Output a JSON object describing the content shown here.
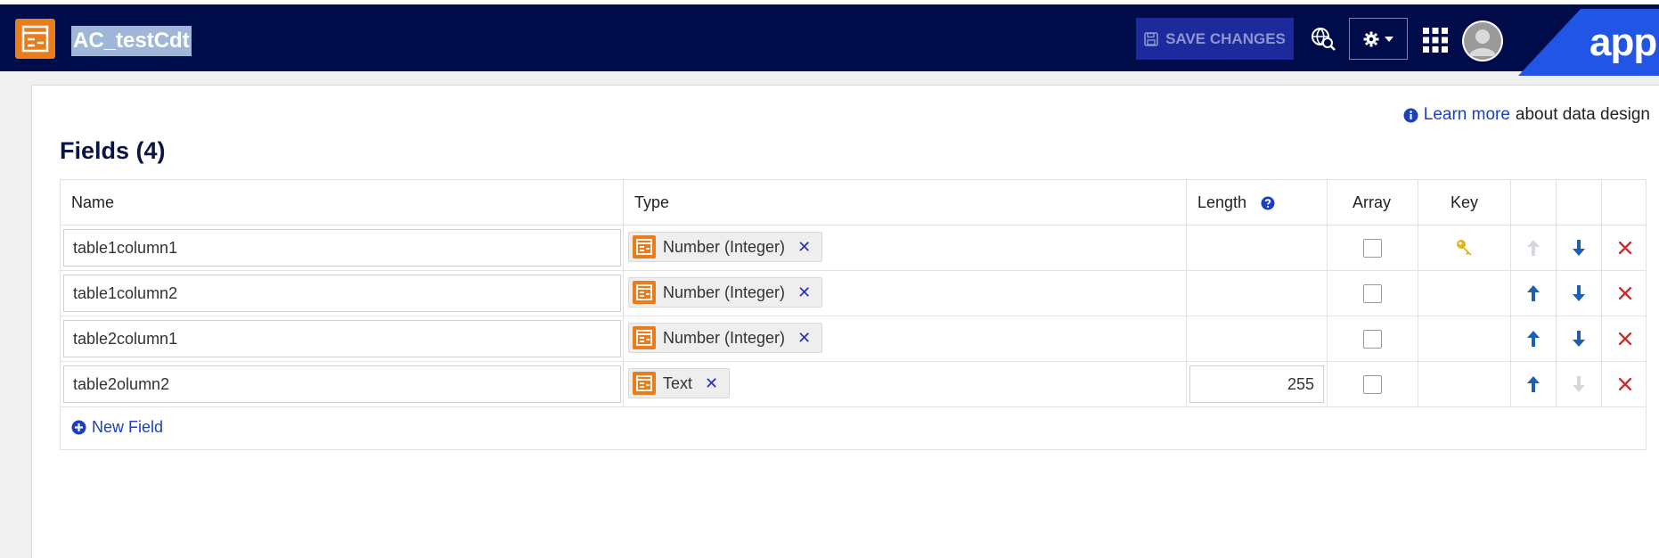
{
  "header": {
    "object_name": "AC_testCdt",
    "save_label": "SAVE CHANGES",
    "brand": "appia",
    "colors": {
      "bar": "#000b4a",
      "accent": "#e87d1e",
      "save_bg": "#1c2a9c",
      "selection": "#9fb6d8"
    }
  },
  "panel": {
    "learn_more_link": "Learn more",
    "learn_more_suffix": "about data design",
    "fields_title": "Fields (4)"
  },
  "table": {
    "columns": {
      "name": "Name",
      "type": "Type",
      "length": "Length",
      "array": "Array",
      "key": "Key"
    },
    "rows": [
      {
        "name": "table1column1",
        "type": "Number (Integer)",
        "length": "",
        "array": false,
        "key": true,
        "up_enabled": false,
        "down_enabled": true
      },
      {
        "name": "table1column2",
        "type": "Number (Integer)",
        "length": "",
        "array": false,
        "key": false,
        "up_enabled": true,
        "down_enabled": true
      },
      {
        "name": "table2column1",
        "type": "Number (Integer)",
        "length": "",
        "array": false,
        "key": false,
        "up_enabled": true,
        "down_enabled": true
      },
      {
        "name": "table2olumn2",
        "type": "Text",
        "length": "255",
        "array": false,
        "key": false,
        "up_enabled": true,
        "down_enabled": false
      }
    ],
    "new_field_label": "New Field"
  }
}
